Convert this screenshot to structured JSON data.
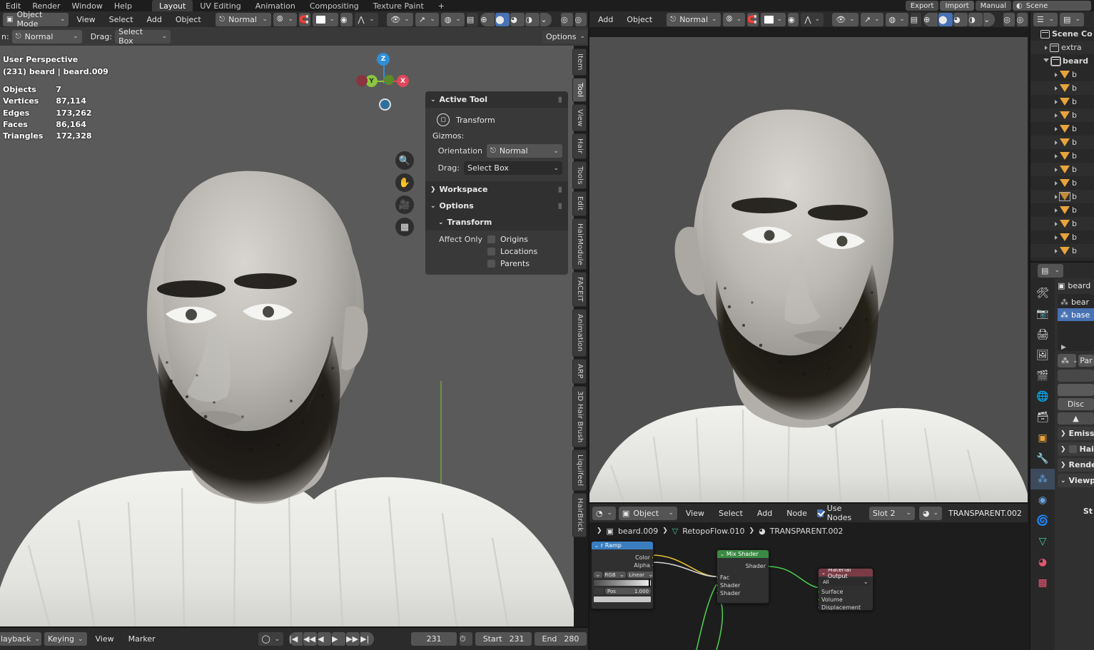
{
  "topbar": {
    "menus": [
      "Edit",
      "Render",
      "Window",
      "Help"
    ],
    "workspaces": [
      {
        "label": "Layout",
        "active": true
      },
      {
        "label": "UV Editing",
        "active": false
      },
      {
        "label": "Animation",
        "active": false
      },
      {
        "label": "Compositing",
        "active": false
      },
      {
        "label": "Texture Paint",
        "active": false
      },
      {
        "label": "+",
        "active": false
      }
    ],
    "right_buttons": [
      "Export",
      "Import",
      "Manual"
    ],
    "scene_name": "Scene"
  },
  "viewport_header_left": {
    "mode": "Object Mode",
    "menus": [
      "View",
      "Select",
      "Add",
      "Object"
    ],
    "orientation": "Normal",
    "options_label": "Options"
  },
  "tool_header_left": {
    "orientation_prefix": "n:",
    "orientation": "Normal",
    "drag_label": "Drag:",
    "drag_value": "Select Box"
  },
  "viewport_header_right": {
    "menus": [
      "Add",
      "Object"
    ],
    "orientation": "Normal"
  },
  "overlay_stats": {
    "perspective": "User Perspective",
    "object_line": "(231) beard | beard.009",
    "rows": [
      {
        "label": "Objects",
        "value": "7"
      },
      {
        "label": "Vertices",
        "value": "87,114"
      },
      {
        "label": "Edges",
        "value": "173,262"
      },
      {
        "label": "Faces",
        "value": "86,164"
      },
      {
        "label": "Triangles",
        "value": "172,328"
      }
    ]
  },
  "gizmo": {
    "axis_z": "Z",
    "axis_x": "X",
    "axis_y": "Y",
    "colors": {
      "x": "#e0485a",
      "y": "#8bc63f",
      "z": "#2f8fd6"
    },
    "buttons": [
      "zoom-icon",
      "hand-icon",
      "camera-icon",
      "grid-icon"
    ]
  },
  "npanel": {
    "active_tool": {
      "title": "Active Tool",
      "tool_name": "Transform",
      "gizmos_label": "Gizmos:",
      "orientation_label": "Orientation",
      "orientation_value": "Normal",
      "drag_label": "Drag:",
      "drag_value": "Select Box"
    },
    "workspace": {
      "title": "Workspace"
    },
    "options": {
      "title": "Options",
      "transform_title": "Transform",
      "affect_only_label": "Affect Only",
      "checkboxes": [
        {
          "label": "Origins",
          "checked": false
        },
        {
          "label": "Locations",
          "checked": false
        },
        {
          "label": "Parents",
          "checked": false
        }
      ]
    }
  },
  "sidebar_tabs": [
    {
      "label": "Item",
      "active": false
    },
    {
      "label": "Tool",
      "active": true
    },
    {
      "label": "View",
      "active": false
    },
    {
      "label": "Hair",
      "active": false
    },
    {
      "label": "Tools",
      "active": false
    },
    {
      "label": "Edit",
      "active": false
    },
    {
      "label": "HairModule",
      "active": false
    },
    {
      "label": "FACEIT",
      "active": false
    },
    {
      "label": "Animation",
      "active": false
    },
    {
      "label": "ARP",
      "active": false
    },
    {
      "label": "3D Hair Brush",
      "active": false
    },
    {
      "label": "Liquifeel",
      "active": false
    },
    {
      "label": "HairBrick",
      "active": false
    }
  ],
  "outliner": {
    "scene_collection": "Scene Co",
    "rows": [
      {
        "label": "extra",
        "type": "collection",
        "indent": 1,
        "expanded": false
      },
      {
        "label": "beard",
        "type": "collection",
        "indent": 1,
        "expanded": true
      },
      {
        "label": "b",
        "type": "mesh",
        "indent": 2,
        "selected": false
      },
      {
        "label": "b",
        "type": "mesh",
        "indent": 2,
        "selected": false
      },
      {
        "label": "b",
        "type": "mesh",
        "indent": 2,
        "selected": false
      },
      {
        "label": "b",
        "type": "mesh",
        "indent": 2,
        "selected": false
      },
      {
        "label": "b",
        "type": "mesh",
        "indent": 2,
        "selected": false
      },
      {
        "label": "b",
        "type": "mesh",
        "indent": 2,
        "selected": false
      },
      {
        "label": "b",
        "type": "mesh",
        "indent": 2,
        "selected": false
      },
      {
        "label": "b",
        "type": "mesh",
        "indent": 2,
        "selected": false
      },
      {
        "label": "b",
        "type": "mesh",
        "indent": 2,
        "selected": false
      },
      {
        "label": "b",
        "type": "mesh",
        "indent": 2,
        "selected": true
      },
      {
        "label": "b",
        "type": "mesh",
        "indent": 2,
        "selected": false
      },
      {
        "label": "b",
        "type": "mesh",
        "indent": 2,
        "selected": false
      },
      {
        "label": "b",
        "type": "mesh",
        "indent": 2,
        "selected": false
      },
      {
        "label": "b",
        "type": "mesh",
        "indent": 2,
        "selected": false
      }
    ]
  },
  "properties": {
    "breadcrumb_object": "beard",
    "particle_list": [
      {
        "label": "bear",
        "selected": false
      },
      {
        "label": "base",
        "selected": true
      }
    ],
    "settings_label": "Par",
    "disconnect_label": "Disc",
    "sections": [
      {
        "label": "Emiss",
        "expanded": false,
        "checkbox": false
      },
      {
        "label": "Hai",
        "expanded": false,
        "checkbox": true
      },
      {
        "label": "Rende",
        "expanded": false,
        "checkbox": false
      },
      {
        "label": "Viewp",
        "expanded": true,
        "checkbox": false
      }
    ],
    "viewport_text": "St",
    "tab_icons": [
      "tool-icon",
      "render-icon",
      "output-icon",
      "view-layer-icon",
      "scene-icon",
      "world-icon",
      "collection-icon",
      "object-icon",
      "modifier-icon",
      "particles-icon",
      "physics-icon",
      "constraints-icon",
      "data-icon",
      "material-icon",
      "texture-icon"
    ]
  },
  "shader_editor": {
    "editor_type": "shader-editor-icon",
    "shader_type": "Object",
    "menus": [
      "View",
      "Select",
      "Add",
      "Node"
    ],
    "use_nodes_label": "Use Nodes",
    "use_nodes_checked": true,
    "slot": "Slot 2",
    "material": "TRANSPARENT.002",
    "breadcrumb": [
      "beard.009",
      "RetopoFlow.010",
      "TRANSPARENT.002"
    ],
    "nodes": [
      {
        "name": "r Ramp",
        "header_color": "#3a7ec0",
        "outputs": [
          "Color",
          "Alpha"
        ],
        "interpolation_mode": "RGB",
        "interpolation": "Linear",
        "pos_label": "Pos",
        "pos_value": "1.000"
      },
      {
        "name": "Mix Shader",
        "header_color": "#3a8a43",
        "outputs": [
          "Shader"
        ],
        "inputs": [
          "Fac",
          "Shader",
          "Shader"
        ]
      },
      {
        "name": "Material Output",
        "header_color": "#7a3b45",
        "target": "All",
        "inputs": [
          "Surface",
          "Volume",
          "Displacement"
        ]
      }
    ]
  },
  "timeline": {
    "playback_label": "layback",
    "keying_label": "Keying",
    "menus": [
      "View",
      "Marker"
    ],
    "current_frame": "231",
    "start_label": "Start",
    "start_value": "231",
    "end_label": "End",
    "end_value": "280"
  }
}
